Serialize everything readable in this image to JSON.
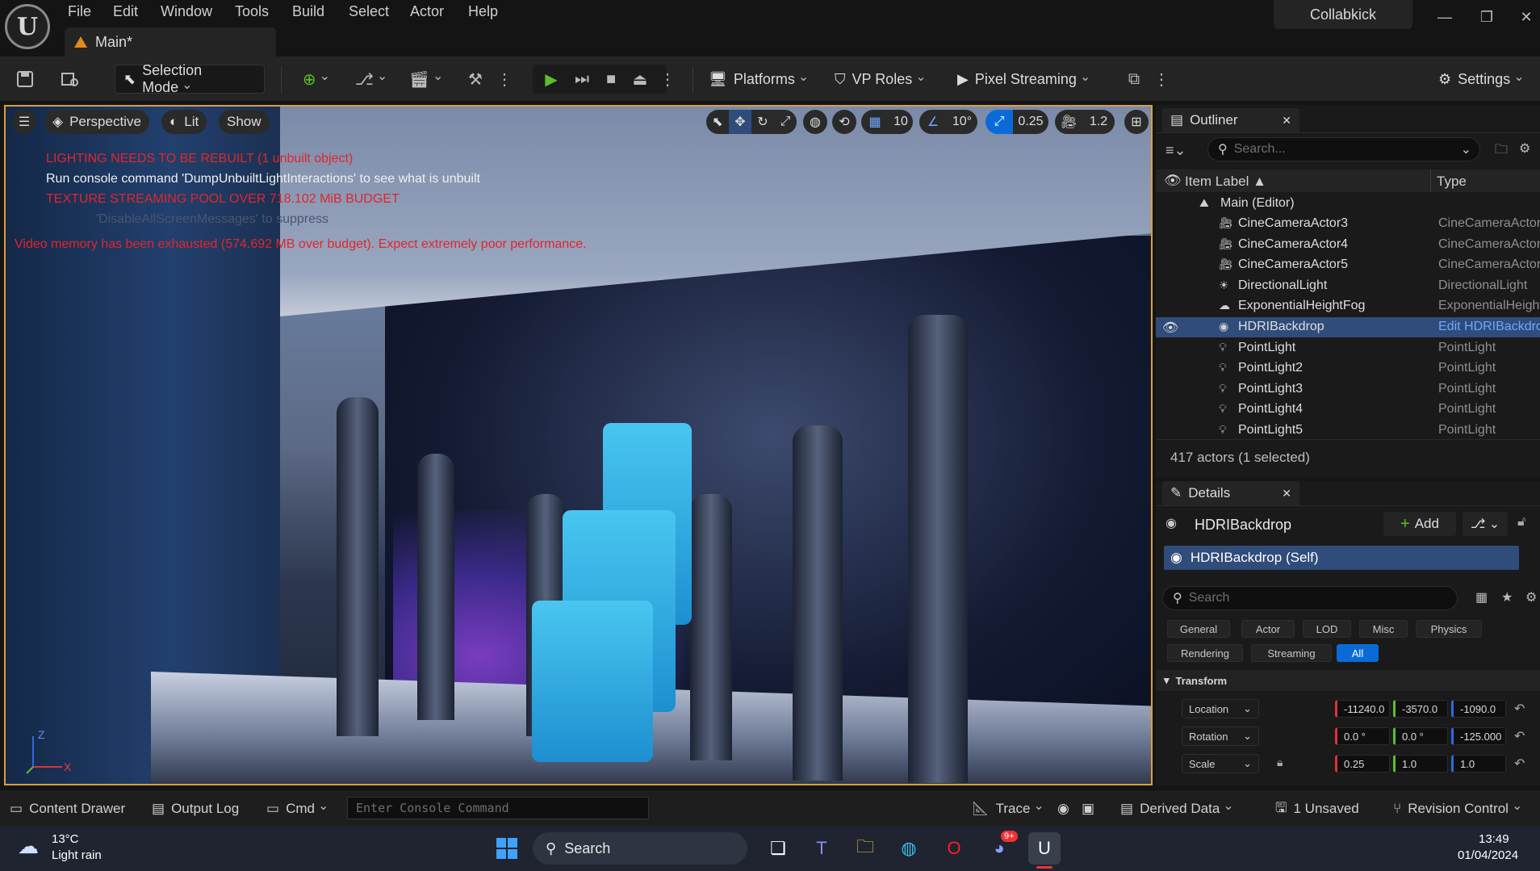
{
  "menu": [
    "File",
    "Edit",
    "Window",
    "Tools",
    "Build",
    "Select",
    "Actor",
    "Help"
  ],
  "document_tab": "Main*",
  "project_name": "Collabkick",
  "toolbar": {
    "selection_mode": "Selection Mode",
    "platforms": "Platforms",
    "vp_roles": "VP Roles",
    "pixel_streaming": "Pixel Streaming",
    "settings": "Settings"
  },
  "viewport": {
    "perspective": "Perspective",
    "lit": "Lit",
    "show": "Show",
    "grid_snap": "10",
    "rotation_snap": "10°",
    "scale_snap": "0.25",
    "camera_speed": "1.2",
    "messages": {
      "lighting": "LIGHTING NEEDS TO BE REBUILT (1 unbuilt object)",
      "console_hint": "Run console command 'DumpUnbuiltLightInteractions' to see what is unbuilt",
      "texture_pool": "TEXTURE STREAMING POOL OVER 718.102 MiB BUDGET",
      "suppress": "'DisableAllScreenMessages' to suppress",
      "video_memory": "Video memory has been exhausted (574.692 MB over budget). Expect extremely poor performance."
    },
    "axes": {
      "z": "Z",
      "x": "X"
    }
  },
  "outliner": {
    "title": "Outliner",
    "search_placeholder": "Search...",
    "col_label": "Item Label ▲",
    "col_type": "Type",
    "root": "Main (Editor)",
    "rows": [
      {
        "label": "CineCameraActor3",
        "type": "CineCameraActor"
      },
      {
        "label": "CineCameraActor4",
        "type": "CineCameraActor"
      },
      {
        "label": "CineCameraActor5",
        "type": "CineCameraActor"
      },
      {
        "label": "DirectionalLight",
        "type": "DirectionalLight"
      },
      {
        "label": "ExponentialHeightFog",
        "type": "ExponentialHeightFog"
      },
      {
        "label": "HDRIBackdrop",
        "type": "Edit HDRIBackdrop"
      },
      {
        "label": "PointLight",
        "type": "PointLight"
      },
      {
        "label": "PointLight2",
        "type": "PointLight"
      },
      {
        "label": "PointLight3",
        "type": "PointLight"
      },
      {
        "label": "PointLight4",
        "type": "PointLight"
      },
      {
        "label": "PointLight5",
        "type": "PointLight"
      }
    ],
    "footer": "417 actors (1 selected)"
  },
  "details": {
    "title": "Details",
    "actor": "HDRIBackdrop",
    "add": "Add",
    "component": "HDRIBackdrop (Self)",
    "search_placeholder": "Search",
    "categories_row1": [
      "General",
      "Actor",
      "LOD",
      "Misc",
      "Physics"
    ],
    "categories_row2": [
      "Rendering",
      "Streaming",
      "All"
    ],
    "section": "Transform",
    "transform": [
      {
        "name": "Location",
        "x": "-11240.0",
        "y": "-3570.0",
        "z": "-1090.0"
      },
      {
        "name": "Rotation",
        "x": "0.0 °",
        "y": "0.0 °",
        "z": "-125.000"
      },
      {
        "name": "Scale",
        "x": "0.25",
        "y": "1.0",
        "z": "1.0"
      }
    ]
  },
  "bottombar": {
    "content_drawer": "Content Drawer",
    "output_log": "Output Log",
    "cmd": "Cmd",
    "console_placeholder": "Enter Console Command",
    "trace": "Trace",
    "derived_data": "Derived Data",
    "unsaved": "1 Unsaved",
    "revision_control": "Revision Control"
  },
  "taskbar": {
    "temperature": "13°C",
    "weather": "Light rain",
    "search": "Search",
    "time": "13:49",
    "date": "01/04/2024",
    "discord_badge": "9+"
  },
  "colors": {
    "accent": "#0a6bd8",
    "viewport_border": "#d9a03a",
    "error_red": "#e0262a",
    "selection": "#2f4c7a"
  }
}
